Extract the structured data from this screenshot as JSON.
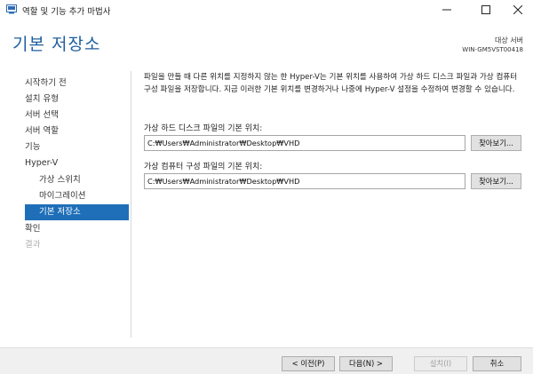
{
  "window": {
    "title": "역할 및 기능 추가 마법사"
  },
  "header": {
    "page_title": "기본 저장소",
    "target_label": "대상 서버",
    "target_name": "WIN-GM5VST00418"
  },
  "nav": {
    "items": [
      {
        "label": "시작하기 전",
        "state": "normal"
      },
      {
        "label": "설치 유형",
        "state": "normal"
      },
      {
        "label": "서버 선택",
        "state": "normal"
      },
      {
        "label": "서버 역할",
        "state": "normal"
      },
      {
        "label": "기능",
        "state": "normal"
      },
      {
        "label": "Hyper-V",
        "state": "normal"
      },
      {
        "label": "가상 스위치",
        "state": "sub"
      },
      {
        "label": "마이그레이션",
        "state": "sub"
      },
      {
        "label": "기본 저장소",
        "state": "selected"
      },
      {
        "label": "확인",
        "state": "normal"
      },
      {
        "label": "결과",
        "state": "disabled"
      }
    ]
  },
  "content": {
    "description": "파일을 만들 때 다른 위치를 지정하지 않는 한 Hyper-V는 기본 위치를 사용하여 가상 하드 디스크 파일과 가상 컴퓨터 구성 파일을 저장합니다. 지금 이러한 기본 위치를 변경하거나 나중에 Hyper-V 설정을 수정하여 변경할 수 있습니다.",
    "vhd_label": "가상 하드 디스크 파일의 기본 위치:",
    "vhd_value": "C:₩Users₩Administrator₩Desktop₩VHD",
    "vm_label": "가상 컴퓨터 구성 파일의 기본 위치:",
    "vm_value": "C:₩Users₩Administrator₩Desktop₩VHD",
    "browse_label": "찾아보기..."
  },
  "footer": {
    "prev_label": "< 이전(P)",
    "next_label": "다음(N) >",
    "install_label": "설치(I)",
    "cancel_label": "취소"
  },
  "colors": {
    "accent": "#1e6fb8",
    "title_blue": "#1f5f9e"
  }
}
